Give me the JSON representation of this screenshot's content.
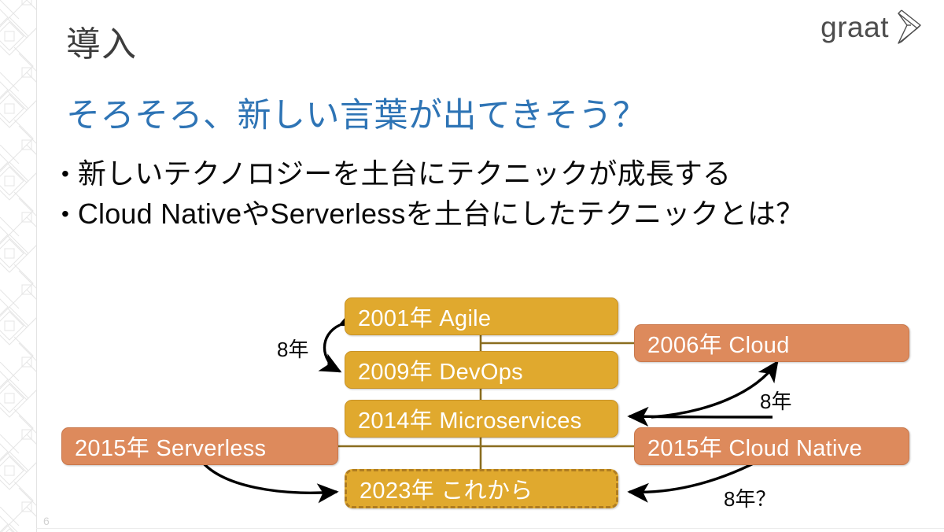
{
  "slide": {
    "title": "導入",
    "subtitle": "そろそろ、新しい言葉が出てきそう？",
    "page_number": "6"
  },
  "logo": {
    "text": "graat",
    "mark_icon": "chevron-right-icon"
  },
  "bullets": [
    {
      "marker": "•",
      "text": "新しいテクノロジーを土台にテクニックが成長する"
    },
    {
      "marker": "•",
      "text": "Cloud NativeやServerlessを土台にしたテクニックとは？"
    }
  ],
  "diagram": {
    "nodes": [
      {
        "id": "agile",
        "label": "2001年 Agile",
        "style": "gold"
      },
      {
        "id": "cloud",
        "label": "2006年 Cloud",
        "style": "orange"
      },
      {
        "id": "devops",
        "label": "2009年 DevOps",
        "style": "gold"
      },
      {
        "id": "microservices",
        "label": "2014年 Microservices",
        "style": "gold"
      },
      {
        "id": "serverless",
        "label": "2015年 Serverless",
        "style": "orange"
      },
      {
        "id": "cloudnative",
        "label": "2015年 Cloud Native",
        "style": "orange"
      },
      {
        "id": "future",
        "label": "2023年 これから",
        "style": "dashed"
      }
    ],
    "edge_labels": [
      {
        "id": "gap-agile-devops",
        "text": "8年"
      },
      {
        "id": "gap-cloudnative-cloud",
        "text": "8年"
      },
      {
        "id": "gap-serverless-future",
        "text": "8年？"
      }
    ]
  },
  "colors": {
    "gold": "#E0A92E",
    "orange": "#DD8A5C",
    "accent_blue": "#2E74B5",
    "connector": "#8a6d1f"
  }
}
